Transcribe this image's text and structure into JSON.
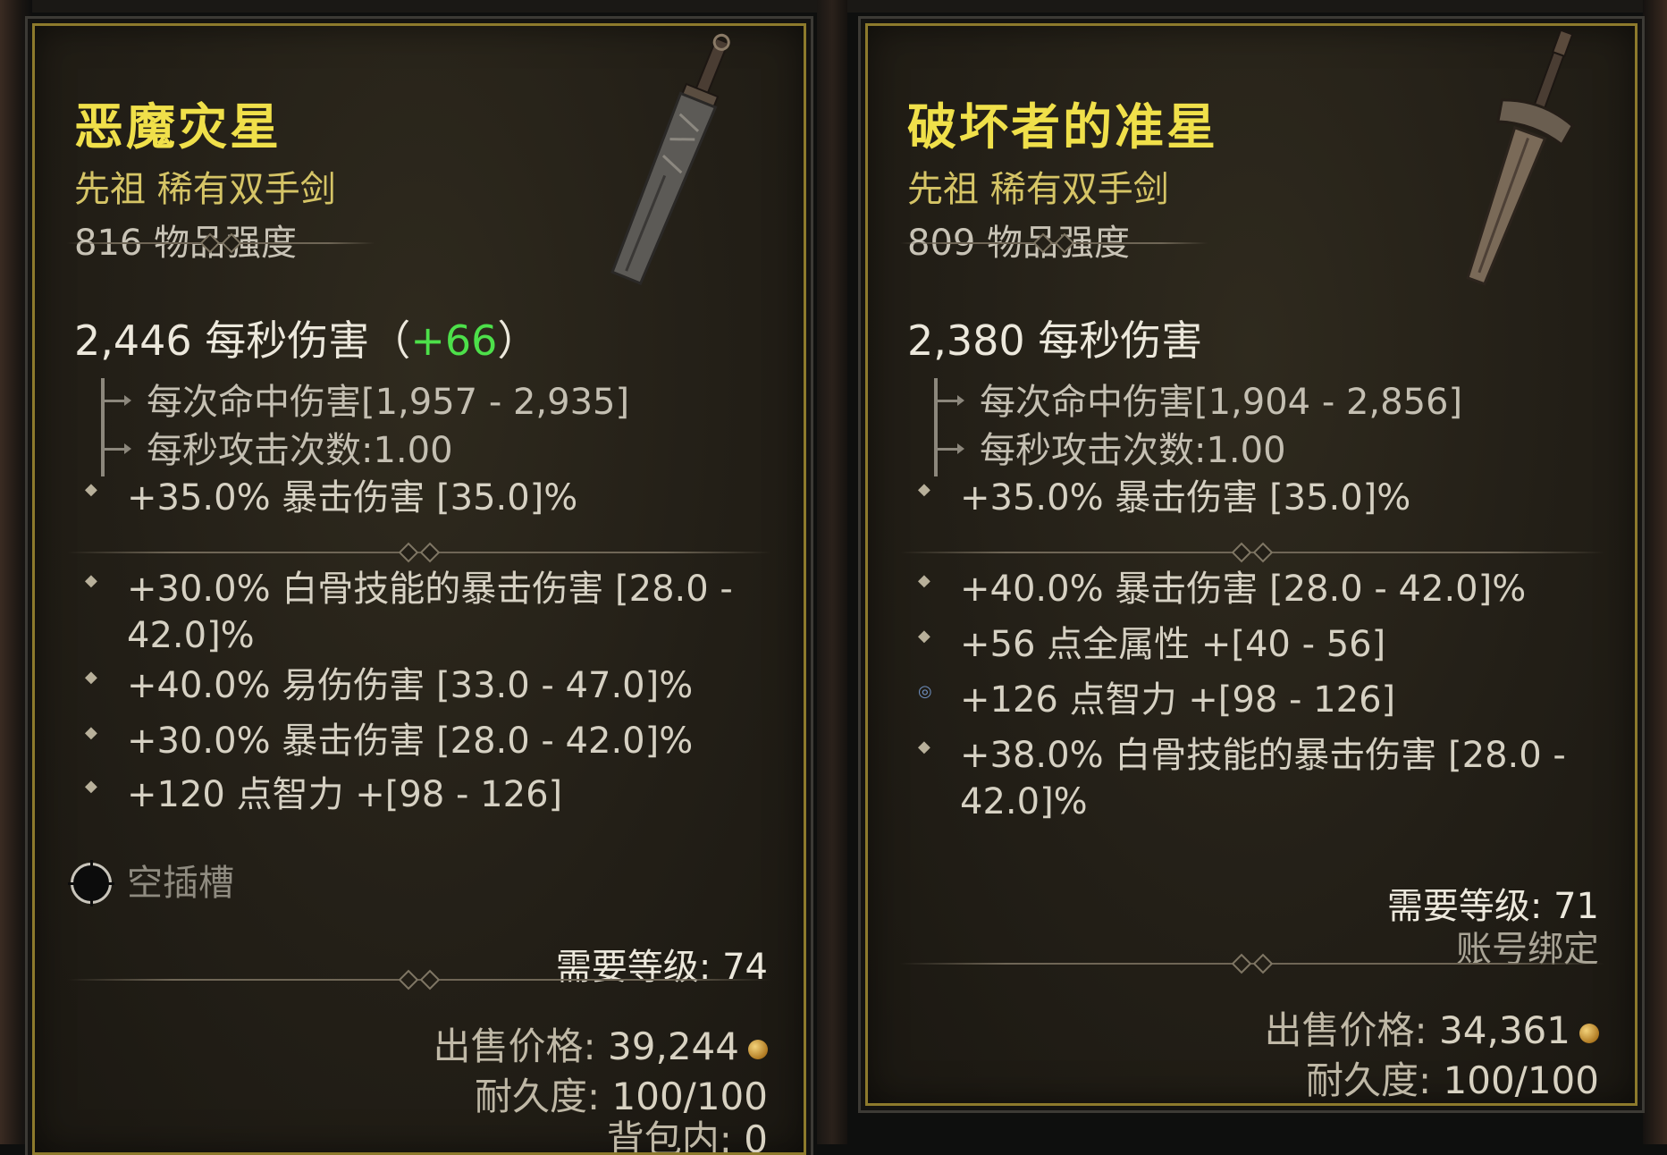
{
  "items": [
    {
      "name": "恶魔灾星",
      "type": "先祖 稀有双手剑",
      "item_power": "816 物品强度",
      "dps": "2,446 每秒伤害",
      "dps_delta": "+66",
      "damage_per_hit": "每次命中伤害[1,957 - 2,935]",
      "attacks_per_second": "每秒攻击次数:1.00",
      "implicit": "+35.0% 暴击伤害 [35.0]%",
      "affixes": [
        "+30.0% 白骨技能的暴击伤害 [28.0 - 42.0]%",
        "+40.0% 易伤伤害 [33.0 - 47.0]%",
        "+30.0% 暴击伤害 [28.0 - 42.0]%",
        "+120 点智力 +[98 - 126]"
      ],
      "socket": "空插槽",
      "required_level": "需要等级: 74",
      "sell_label": "出售价格:",
      "sell_value": "39,244",
      "durability_label": "耐久度:",
      "durability_value": "100/100",
      "in_bag_label": "背包内:",
      "in_bag_value": "0"
    },
    {
      "name": "破坏者的准星",
      "type": "先祖 稀有双手剑",
      "item_power": "809 物品强度",
      "dps": "2,380 每秒伤害",
      "damage_per_hit": "每次命中伤害[1,904 - 2,856]",
      "attacks_per_second": "每秒攻击次数:1.00",
      "implicit": "+35.0% 暴击伤害 [35.0]%",
      "affixes": [
        "+40.0% 暴击伤害 [28.0 - 42.0]%",
        "+56 点全属性 +[40 - 56]",
        "+126 点智力 +[98 - 126]",
        "+38.0% 白骨技能的暴击伤害 [28.0 - 42.0]%"
      ],
      "required_level": "需要等级: 71",
      "account_bound": "账号绑定",
      "sell_label": "出售价格:",
      "sell_value": "34,361",
      "durability_label": "耐久度:",
      "durability_value": "100/100"
    }
  ],
  "colors": {
    "title": "#f0e04a",
    "subtitle": "#d5c466",
    "delta_positive": "#4de04a",
    "border": "#8d7a2c"
  }
}
